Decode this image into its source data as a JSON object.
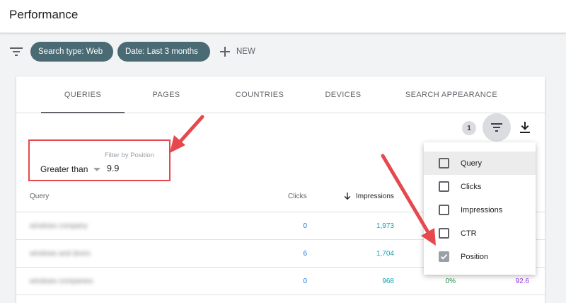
{
  "header": {
    "title": "Performance"
  },
  "toolbar": {
    "filter_icon": "filter-lines-icon",
    "chips": [
      {
        "label": "Search type: Web",
        "icon": "pencil-icon"
      },
      {
        "label": "Date: Last 3 months",
        "icon": "pencil-icon"
      }
    ],
    "new_label": "NEW",
    "new_icon": "plus-icon"
  },
  "tabs": [
    "QUERIES",
    "PAGES",
    "COUNTRIES",
    "DEVICES",
    "SEARCH APPEARANCE"
  ],
  "active_tab": "QUERIES",
  "table_controls": {
    "filter_count": "1",
    "filter_icon": "filter-lines-icon",
    "download_icon": "download-icon"
  },
  "position_filter": {
    "caption": "Filter by Position",
    "operator": "Greater than",
    "value": "9.9"
  },
  "table": {
    "headers": {
      "query": "Query",
      "clicks": "Clicks",
      "impressions": "Impressions"
    },
    "rows": [
      {
        "query": "windows company",
        "clicks": "0",
        "impressions": "1,973",
        "ctr": "",
        "position": ""
      },
      {
        "query": "windows and doors",
        "clicks": "6",
        "impressions": "1,704",
        "ctr": "",
        "position": ""
      },
      {
        "query": "windows companies",
        "clicks": "0",
        "impressions": "968",
        "ctr": "0%",
        "position": "92.6"
      }
    ]
  },
  "column_menu": {
    "items": [
      {
        "label": "Query",
        "checked": false
      },
      {
        "label": "Clicks",
        "checked": false
      },
      {
        "label": "Impressions",
        "checked": false
      },
      {
        "label": "CTR",
        "checked": false
      },
      {
        "label": "Position",
        "checked": true
      }
    ]
  },
  "colors": {
    "chip_bg": "#4a6a74",
    "clicks": "#1a73e8",
    "impressions": "#12a4af",
    "ctr": "#1e8e3e",
    "position": "#9334e6",
    "annotation": "#e5484d"
  }
}
